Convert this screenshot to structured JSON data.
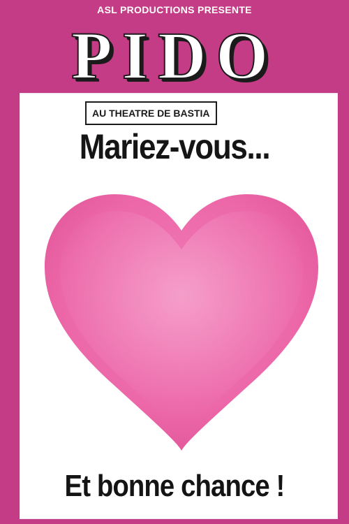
{
  "poster": {
    "top_line": "ASL PRODUCTIONS PRESENTE",
    "title": "PIDO",
    "venue": "AU THEATRE DE BASTIA",
    "headline": "Mariez-vous...",
    "footer": "Et bonne chance !"
  },
  "colors": {
    "frame_pink": "#c53c86",
    "panel_white": "#ffffff",
    "heart_pink": "#ef86bd",
    "text_black": "#151515"
  },
  "icons": {
    "heart": "heart-icon"
  }
}
